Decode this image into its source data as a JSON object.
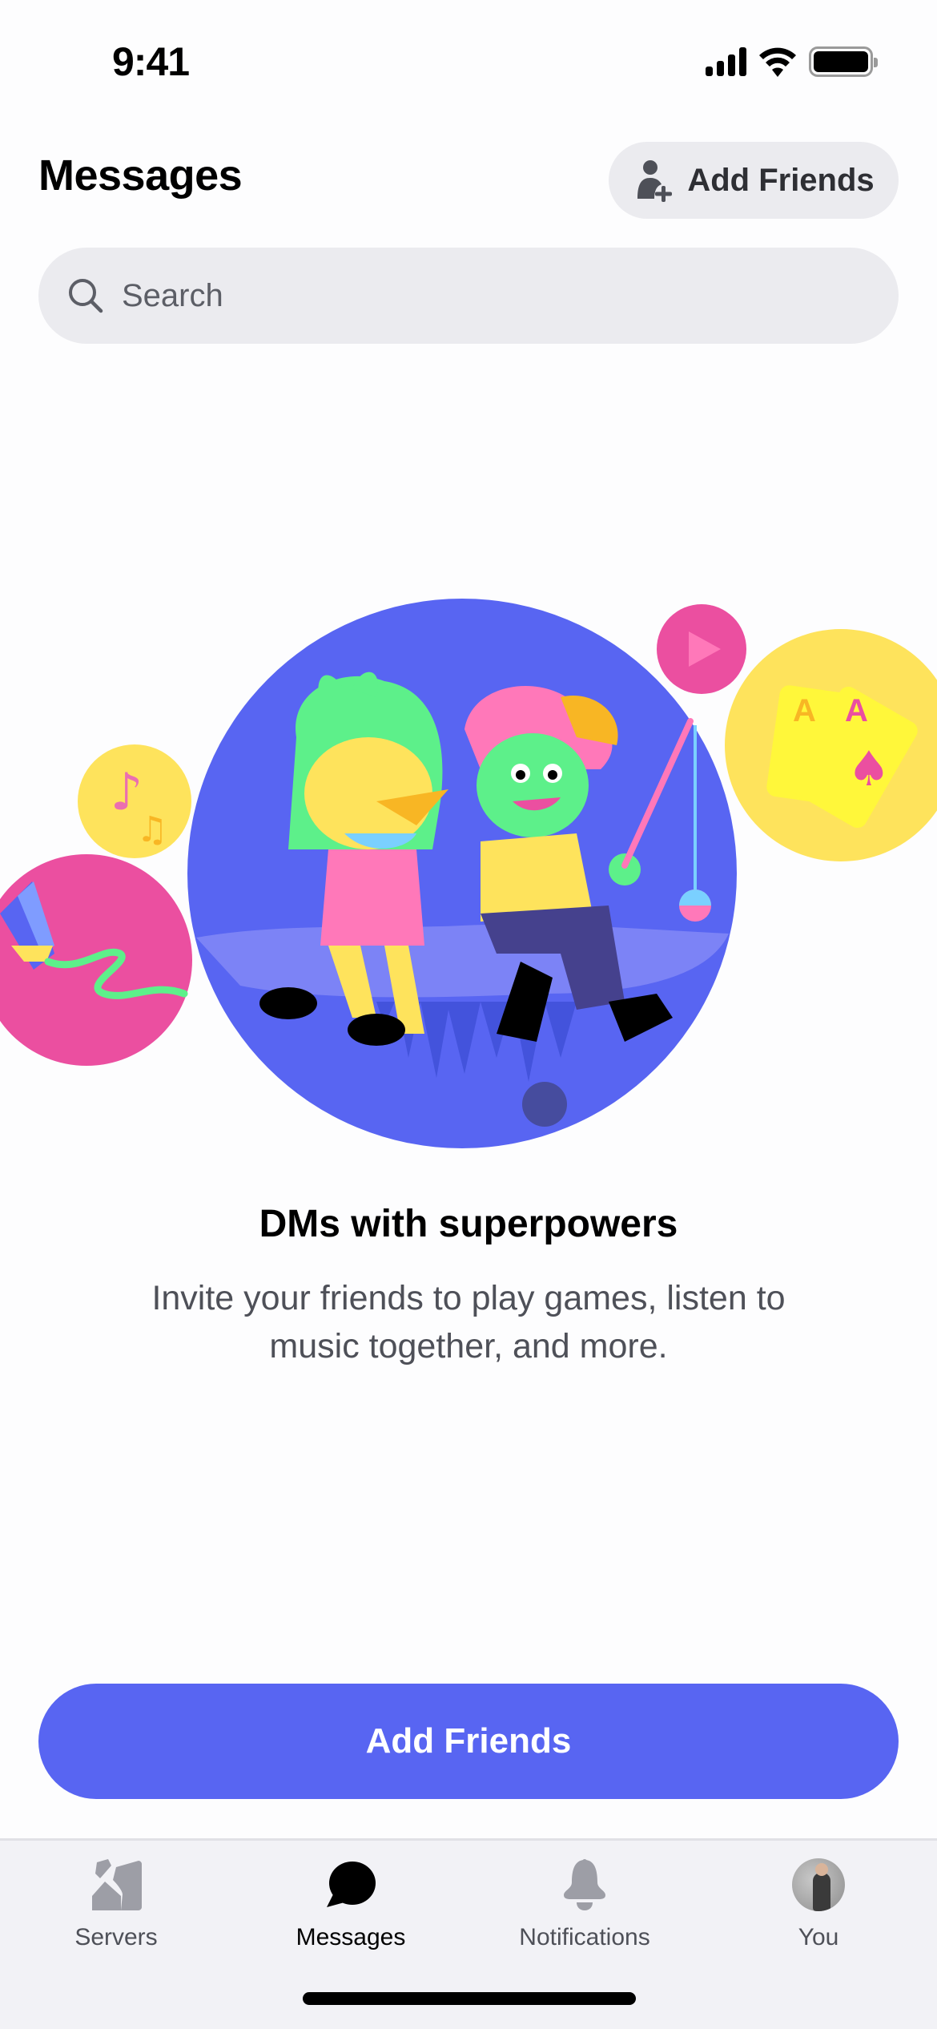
{
  "status_bar": {
    "time": "9:41",
    "icons": [
      "cellular-signal-icon",
      "wifi-icon",
      "battery-icon"
    ]
  },
  "header": {
    "title": "Messages",
    "add_friends_button": {
      "label": "Add Friends",
      "icon": "add-friend-icon"
    }
  },
  "search": {
    "placeholder": "Search",
    "value": "",
    "icon": "search-icon"
  },
  "illustration": {
    "description": "Two cartoon characters sitting together with bubbles for music, play, cards and drawing",
    "colors": {
      "main_circle": "#5865f2",
      "pink": "#eb4fa0",
      "yellow": "#fee35c",
      "green": "#5df08a"
    }
  },
  "empty_state": {
    "title": "DMs with superpowers",
    "description": "Invite your friends to play games, listen to music together, and more."
  },
  "cta": {
    "label": "Add Friends",
    "color": "#5865f2"
  },
  "tab_bar": {
    "tabs": [
      {
        "label": "Servers",
        "icon": "servers-icon",
        "active": false
      },
      {
        "label": "Messages",
        "icon": "messages-icon",
        "active": true
      },
      {
        "label": "Notifications",
        "icon": "bell-icon",
        "active": false
      },
      {
        "label": "You",
        "icon": "avatar",
        "active": false
      }
    ]
  }
}
